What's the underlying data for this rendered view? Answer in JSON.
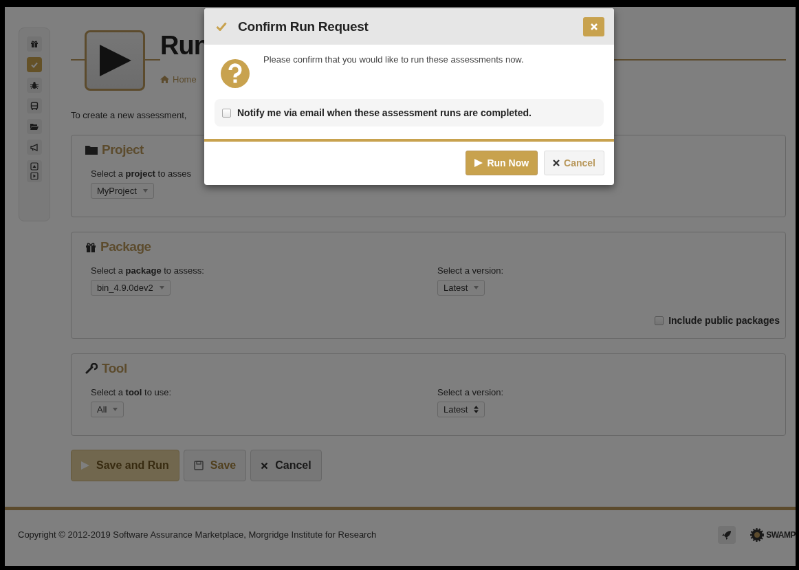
{
  "sidebar": {
    "items": [
      {
        "kind": "gift",
        "selected": false
      },
      {
        "kind": "check",
        "selected": true
      },
      {
        "kind": "bug",
        "selected": false
      },
      {
        "kind": "bus",
        "selected": false
      },
      {
        "kind": "folder",
        "selected": false
      },
      {
        "kind": "megaphone",
        "selected": false
      },
      {
        "kind": "pair",
        "selected": false
      }
    ]
  },
  "header": {
    "title": "Run",
    "breadcrumb": "Home",
    "intro": "To create a new assessment,"
  },
  "sections": [
    {
      "kind": "project",
      "title": "Project",
      "fields": [
        {
          "label": "Select a **project** to asses",
          "value": "MyProject",
          "kind": "dropdown"
        }
      ]
    },
    {
      "kind": "package",
      "title": "Package",
      "fields": [
        {
          "label": "Select a **package** to assess:",
          "value": "bin_4.9.0dev2",
          "kind": "dropdown"
        },
        {
          "label": "Select a version:",
          "value": "Latest",
          "kind": "dropdown"
        }
      ],
      "option": {
        "label": "Include public packages",
        "checked": false
      }
    },
    {
      "kind": "tool",
      "title": "Tool",
      "fields": [
        {
          "label": "Select a **tool** to use:",
          "value": "All",
          "kind": "dropdown"
        },
        {
          "label": "Select a version:",
          "value": "Latest",
          "kind": "spinner"
        }
      ]
    }
  ],
  "actions": [
    {
      "kind": "run",
      "label": "Save and Run",
      "disabled": true
    },
    {
      "kind": "save",
      "label": "Save",
      "disabled": true
    },
    {
      "kind": "cancel",
      "label": "Cancel",
      "disabled": false
    }
  ],
  "footer": {
    "copyright": "Copyright © 2012-2019 Software Assurance Marketplace, Morgridge Institute for Research",
    "logo": "SWAMP"
  },
  "dialog": {
    "title": "Confirm Run Request",
    "message": "Please confirm that you would like to run these assessments now.",
    "notify": {
      "label": "Notify me via email when these assessment runs are completed.",
      "checked": false
    },
    "buttons": [
      {
        "kind": "primary",
        "label": "Run Now"
      },
      {
        "kind": "cancel",
        "label": "Cancel"
      }
    ]
  }
}
